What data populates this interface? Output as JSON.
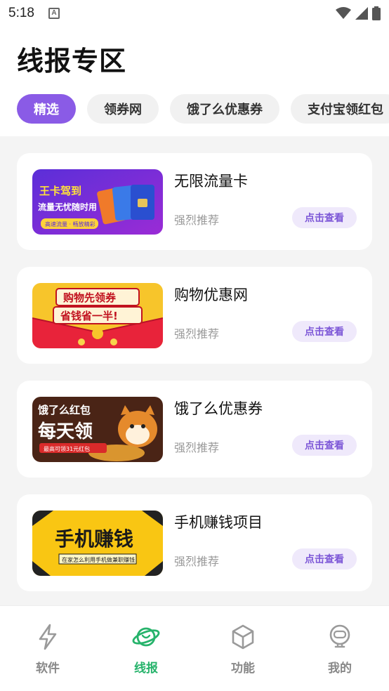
{
  "status_bar": {
    "time": "5:18",
    "notif_letter": "A"
  },
  "page_title": "线报专区",
  "tabs": [
    {
      "label": "精选",
      "active": true
    },
    {
      "label": "领券网",
      "active": false
    },
    {
      "label": "饿了么优惠券",
      "active": false
    },
    {
      "label": "支付宝领红包",
      "active": false
    }
  ],
  "cards": [
    {
      "title": "无限流量卡",
      "subtitle": "强烈推荐",
      "button": "点击查看",
      "banner": {
        "line1": "王卡驾到",
        "line2": "流量无忧随时用",
        "line3": "高速流量 · 畅放精彩"
      }
    },
    {
      "title": "购物优惠网",
      "subtitle": "强烈推荐",
      "button": "点击查看",
      "banner": {
        "line1": "购物先领券",
        "line2": "省钱省一半!"
      }
    },
    {
      "title": "饿了么优惠券",
      "subtitle": "强烈推荐",
      "button": "点击查看",
      "banner": {
        "line1": "饿了么红包",
        "line2": "每天领",
        "line3": "最高可领31元红包"
      }
    },
    {
      "title": "手机赚钱项目",
      "subtitle": "强烈推荐",
      "button": "点击查看",
      "banner": {
        "line1": "手机赚钱",
        "line2": "在家怎么利用手机做兼职赚钱"
      }
    }
  ],
  "bottom_nav": [
    {
      "label": "软件",
      "icon": "lightning-icon",
      "active": false
    },
    {
      "label": "线报",
      "icon": "planet-icon",
      "active": true
    },
    {
      "label": "功能",
      "icon": "cube-icon",
      "active": false
    },
    {
      "label": "我的",
      "icon": "robot-face-icon",
      "active": false
    }
  ],
  "colors": {
    "accent": "#8a5be6",
    "nav_active": "#26b36b"
  }
}
